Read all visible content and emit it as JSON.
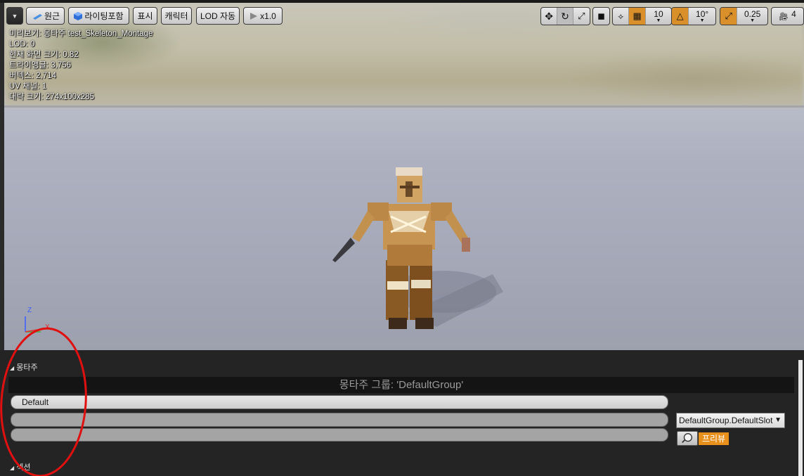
{
  "toolbar": {
    "perspective": "원근",
    "lighting": "라이팅포함",
    "show": "표시",
    "character": "캐릭터",
    "lod": "LOD 자동",
    "speed": "x1.0",
    "grid_snap": "10",
    "rotation_snap": "10°",
    "scale_snap": "0.25",
    "camera_speed": "4"
  },
  "stats": {
    "preview": "미리보기: 몽타주 test_Skeleton_Montage",
    "lod": "LOD: 0",
    "screen_size": "현재 화면 크기: 0.82",
    "triangles": "트라이앵글: 3,756",
    "vertices": "버텍스: 2,714",
    "uv_channels": "UV 채널: 1",
    "approx_size": "대략 크기: 274x100x285"
  },
  "axis": {
    "z": "Z",
    "x": "X"
  },
  "montage": {
    "section_title": "몽타주",
    "group_bar": "몽타주 그룹: 'DefaultGroup'",
    "track_label": "Default",
    "slot": "DefaultGroup.DefaultSlot",
    "preview_button": "프리뷰",
    "sections_title": "섹션"
  },
  "colors": {
    "accent_orange": "#d9902a",
    "panel_bg": "#242424",
    "annotation_red": "#e01010"
  }
}
